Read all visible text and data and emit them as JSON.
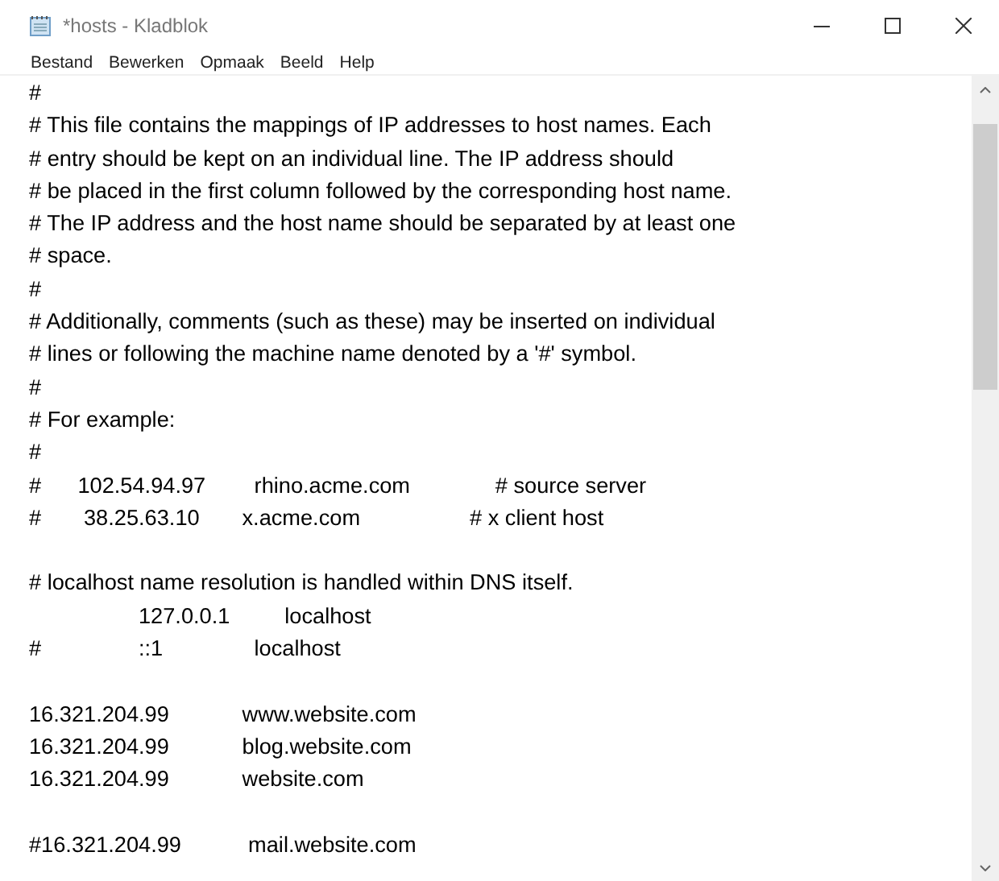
{
  "window": {
    "title": "*hosts - Kladblok"
  },
  "menu": [
    "Bestand",
    "Bewerken",
    "Opmaak",
    "Beeld",
    "Help"
  ],
  "lines": [
    {
      "kind": "text",
      "text": "#"
    },
    {
      "kind": "text",
      "text": "# This file contains the mappings of IP addresses to host names. Each"
    },
    {
      "kind": "text",
      "text": "# entry should be kept on an individual line. The IP address should"
    },
    {
      "kind": "text",
      "text": "# be placed in the first column followed by the corresponding host name."
    },
    {
      "kind": "text",
      "text": "# The IP address and the host name should be separated by at least one"
    },
    {
      "kind": "text",
      "text": "# space."
    },
    {
      "kind": "text",
      "text": "#"
    },
    {
      "kind": "text",
      "text": "# Additionally, comments (such as these) may be inserted on individual"
    },
    {
      "kind": "text",
      "text": "# lines or following the machine name denoted by a '#' symbol."
    },
    {
      "kind": "text",
      "text": "#"
    },
    {
      "kind": "text",
      "text": "# For example:"
    },
    {
      "kind": "text",
      "text": "#"
    },
    {
      "kind": "text",
      "text": "#      102.54.94.97        rhino.acme.com              # source server"
    },
    {
      "kind": "text",
      "text": "#       38.25.63.10       x.acme.com                  # x client host"
    },
    {
      "kind": "blank"
    },
    {
      "kind": "text",
      "text": "# localhost name resolution is handled within DNS itself."
    },
    {
      "kind": "text",
      "text": "                  127.0.0.1         localhost"
    },
    {
      "kind": "text",
      "text": "#                ::1               localhost"
    },
    {
      "kind": "blank"
    },
    {
      "kind": "text",
      "text": "16.321.204.99            www.website.com"
    },
    {
      "kind": "text",
      "text": "16.321.204.99            blog.website.com"
    },
    {
      "kind": "text",
      "text": "16.321.204.99            website.com"
    },
    {
      "kind": "blank"
    },
    {
      "kind": "text",
      "text": "#16.321.204.99           mail.website.com"
    }
  ]
}
